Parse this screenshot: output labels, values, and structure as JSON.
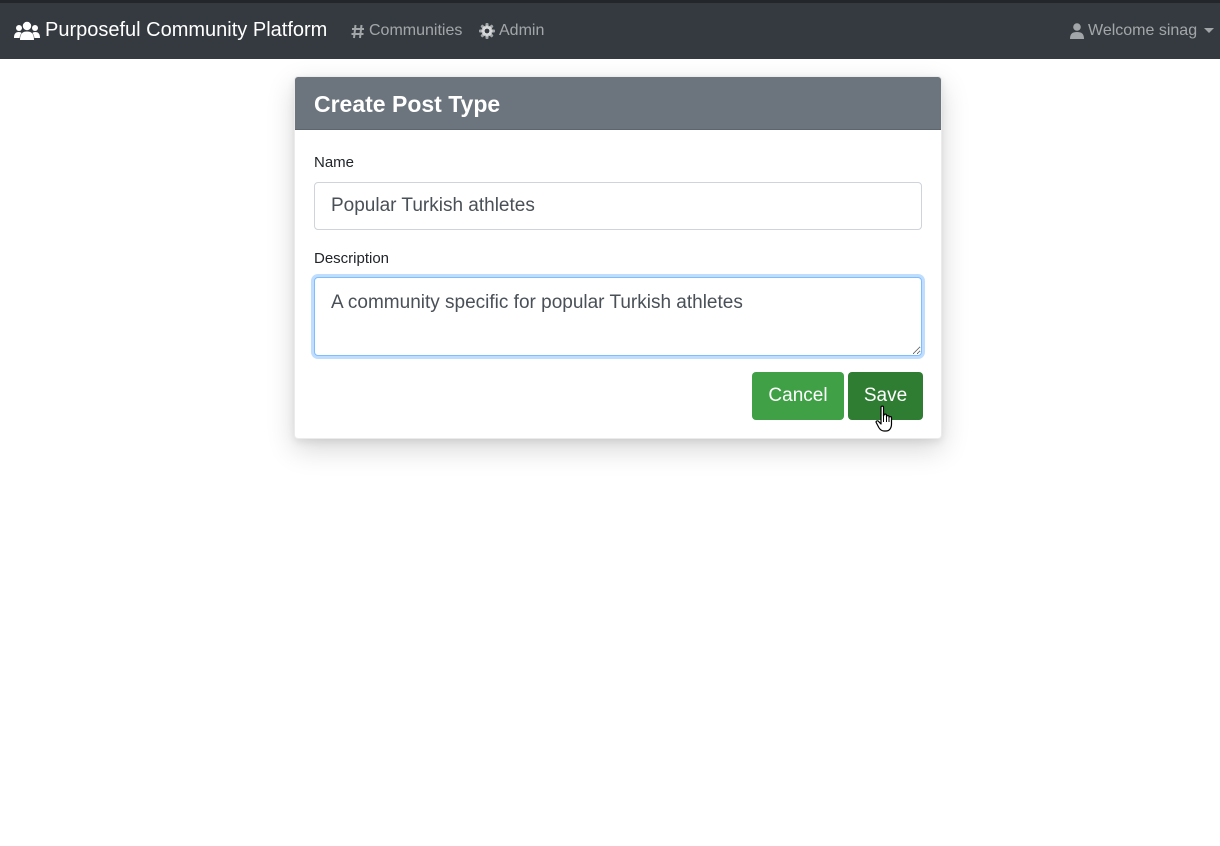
{
  "navbar": {
    "brand": "Purposeful Community Platform",
    "brand_icon": "users-icon",
    "links": [
      {
        "label": "Communities",
        "icon": "hashtag-icon"
      },
      {
        "label": "Admin",
        "icon": "gear-icon"
      }
    ],
    "user_menu": {
      "label": "Welcome sinag",
      "icon": "user-icon"
    }
  },
  "form": {
    "title": "Create Post Type",
    "name_label": "Name",
    "name_value": "Popular Turkish athletes",
    "description_label": "Description",
    "description_value": "A community specific for popular Turkish athletes",
    "cancel_label": "Cancel",
    "save_label": "Save"
  },
  "colors": {
    "navbar_bg": "#343a40",
    "header_bg": "#6c757d",
    "cancel_bg": "#3fa046",
    "save_bg": "#2e7d32",
    "focus_border": "#80bdff"
  }
}
